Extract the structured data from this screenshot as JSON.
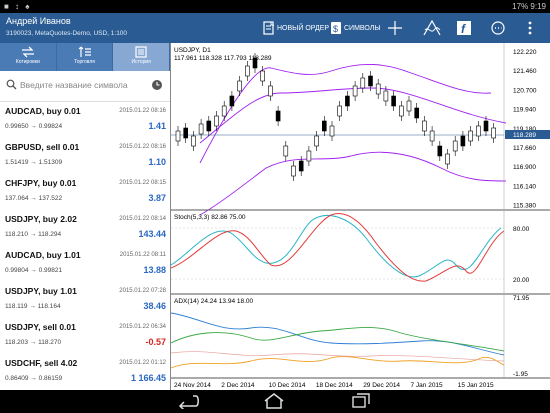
{
  "status_bar": {
    "left": "■ ↕ ♠",
    "battery": "17%",
    "time": "9:19"
  },
  "header": {
    "user_name": "Андрей Иванов",
    "account": "3190023, MetaQuotes-Demo, USD, 1:100",
    "new_order_label": "НОВЫЙ ОРДЕР",
    "symbols_label": "СИМВОЛЫ"
  },
  "tabs": [
    {
      "label": "Котировки",
      "icon": "quotes-icon"
    },
    {
      "label": "Торговля",
      "icon": "trade-icon"
    },
    {
      "label": "История",
      "icon": "history-icon",
      "active": true
    }
  ],
  "search": {
    "placeholder": "Введите название символа"
  },
  "deals": [
    {
      "title": "AUDCAD, buy 0.01",
      "time": "2015.01.22 08:16",
      "prices": "0.99650 → 0.99824",
      "profit": "1.41"
    },
    {
      "title": "GBPUSD, sell 0.01",
      "time": "2015.01.22 08:16",
      "prices": "1.51419 → 1.51309",
      "profit": "1.10"
    },
    {
      "title": "CHFJPY, buy 0.01",
      "time": "2015.01.22 08:15",
      "prices": "137.064 → 137.522",
      "profit": "3.87"
    },
    {
      "title": "USDJPY, buy 2.02",
      "time": "2015.01.22 08:14",
      "prices": "118.210 → 118.294",
      "profit": "143.44"
    },
    {
      "title": "AUDCAD, buy 1.01",
      "time": "2015.01.22 08:11",
      "prices": "0.99804 → 0.99821",
      "profit": "13.88"
    },
    {
      "title": "USDJPY, buy 1.01",
      "time": "2015.01.22 07:28",
      "prices": "118.119 → 118.164",
      "profit": "38.46"
    },
    {
      "title": "USDJPY, sell 0.01",
      "time": "2015.01.22 06:34",
      "prices": "118.203 → 118.270",
      "profit": "-0.57",
      "negative": true
    },
    {
      "title": "USDCHF, sell 4.02",
      "time": "2015.01.22 01:12",
      "prices": "0.86409 → 0.86159",
      "profit": "1 166.45"
    }
  ],
  "chart": {
    "symbol_label": "USDJPY, D1",
    "ohlc_label": "117.961 118.328 117.793 118.289",
    "price_axis": [
      "122.220",
      "121.460",
      "120.700",
      "119.940",
      "119.180",
      "118.289",
      "117.660",
      "116.900",
      "116.140",
      "115.380"
    ],
    "current_price": "118.289",
    "stoch_label": "Stoch(5,3,3) 82.86 75.00",
    "stoch_axis": [
      "80.00",
      "20.00"
    ],
    "adx_label": "ADX(14) 24.24 13.94 18.00",
    "adx_axis": [
      "71.95",
      "-1.95"
    ],
    "time_axis": [
      "24 Nov 2014",
      "2 Dec 2014",
      "10 Dec 2014",
      "18 Dec 2014",
      "29 Dec 2014",
      "7 Jan 2015",
      "15 Jan 2015"
    ],
    "colors": {
      "bullish": "#ffffff",
      "bearish": "#000000",
      "envelope": "#a020f0",
      "stoch_main": "#29b6c6",
      "stoch_signal": "#e23b3b",
      "adx_main": "#2d7fd3",
      "plus_di": "#3aa845",
      "minus_di": "#f0a020",
      "current_line": "#2a5c93"
    }
  }
}
